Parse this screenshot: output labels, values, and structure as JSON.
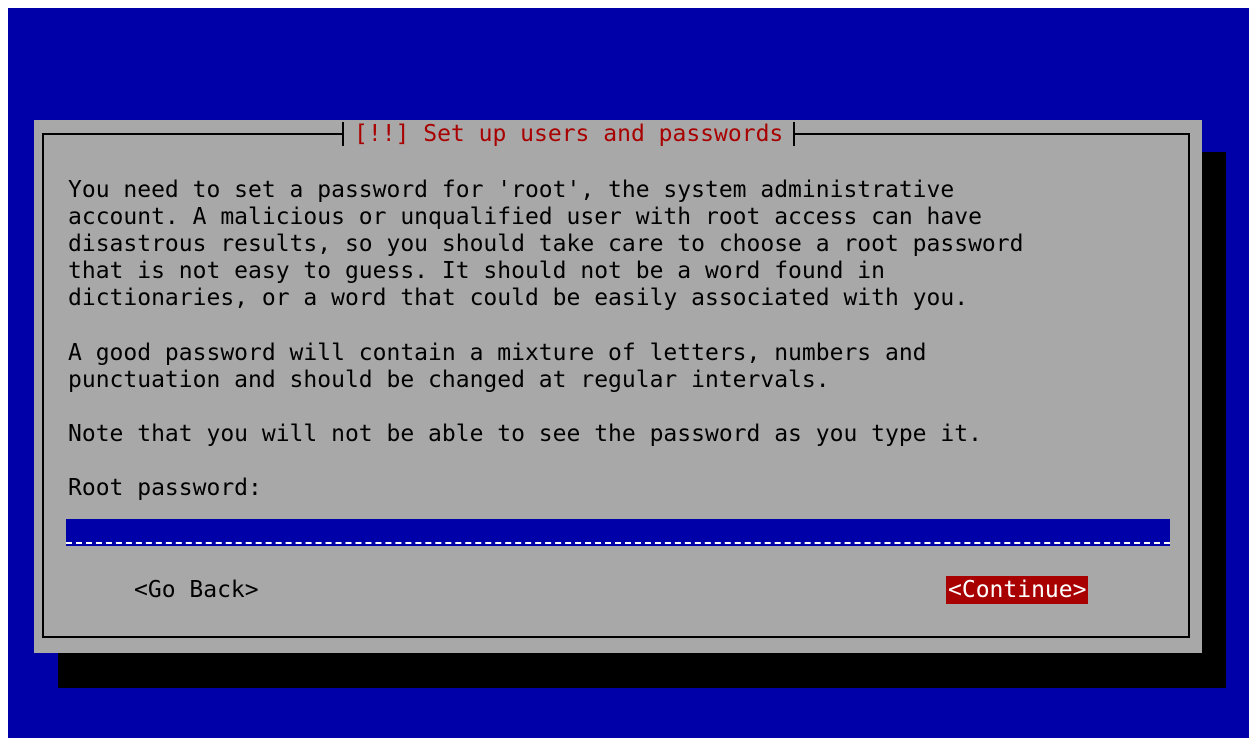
{
  "dialog": {
    "title": "[!!] Set up users and passwords",
    "paragraph1": "You need to set a password for 'root', the system administrative\naccount. A malicious or unqualified user with root access can have\ndisastrous results, so you should take care to choose a root password\nthat is not easy to guess. It should not be a word found in\ndictionaries, or a word that could be easily associated with you.",
    "paragraph2": "A good password will contain a mixture of letters, numbers and\npunctuation and should be changed at regular intervals.",
    "paragraph3": "Note that you will not be able to see the password as you type it.",
    "field_label": "Root password:",
    "password_masked": "*******"
  },
  "buttons": {
    "back_label": "<Go Back>",
    "continue_label": "<Continue>"
  },
  "colors": {
    "background": "#0000a8",
    "dialog": "#a8a8a8",
    "title": "#a80000",
    "selected_button": "#a80000",
    "input_background": "#0000a8"
  }
}
